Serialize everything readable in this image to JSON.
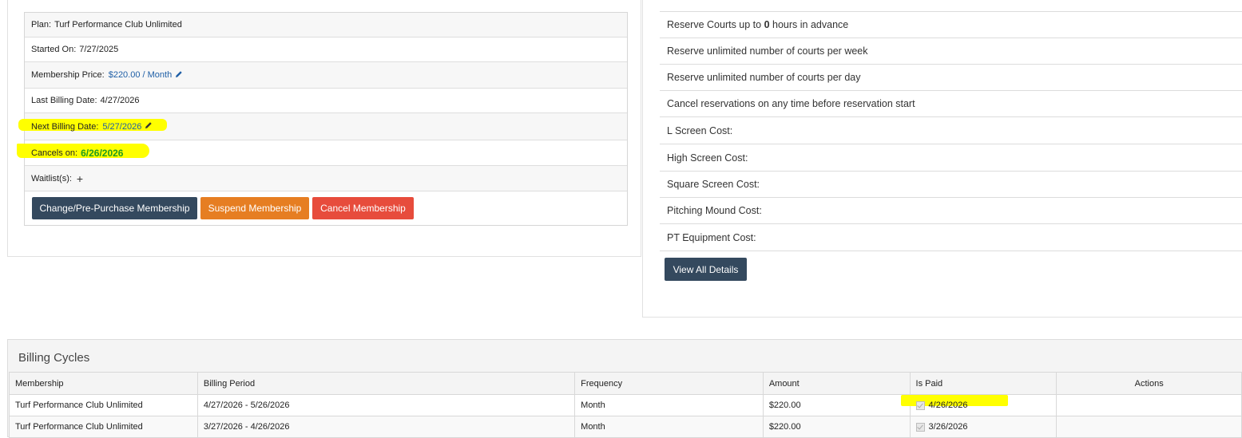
{
  "membership": {
    "plan_label": "Plan:",
    "plan_value": "Turf Performance Club Unlimited",
    "started_label": "Started On:",
    "started_value": "7/27/2025",
    "price_label": "Membership Price:",
    "price_value": "$220.00 / Month",
    "last_billing_label": "Last Billing Date:",
    "last_billing_value": "4/27/2026",
    "next_billing_label": "Next Billing Date:",
    "next_billing_value": "5/27/2026",
    "cancels_label": "Cancels on:",
    "cancels_value": "6/26/2026",
    "waitlist_label": "Waitlist(s):",
    "waitlist_add": "+",
    "buttons": {
      "change": "Change/Pre-Purchase Membership",
      "suspend": "Suspend Membership",
      "cancel": "Cancel Membership"
    }
  },
  "benefits": {
    "reserve_prefix": "Reserve Courts up to ",
    "reserve_hours": "0",
    "reserve_suffix": " hours in advance",
    "items": [
      "Reserve unlimited number of courts per week",
      "Reserve unlimited number of courts per day",
      "Cancel reservations on any time before reservation start",
      "L Screen Cost:",
      "High Screen Cost:",
      "Square Screen Cost:",
      "Pitching Mound Cost:",
      "PT Equipment Cost:"
    ],
    "view_all_label": "View All Details"
  },
  "billing": {
    "title": "Billing Cycles",
    "columns": [
      "Membership",
      "Billing Period",
      "Frequency",
      "Amount",
      "Is Paid",
      "Actions"
    ],
    "rows": [
      {
        "membership": "Turf Performance Club Unlimited",
        "period": "4/27/2026 - 5/26/2026",
        "frequency": "Month",
        "amount": "$220.00",
        "paid_date": "4/26/2026"
      },
      {
        "membership": "Turf Performance Club Unlimited",
        "period": "3/27/2026 - 4/26/2026",
        "frequency": "Month",
        "amount": "$220.00",
        "paid_date": "3/26/2026"
      }
    ]
  },
  "colors": {
    "dark_button": "#34495e",
    "orange_button": "#e67e22",
    "red_button": "#e74c3c",
    "link": "#1f5fa6",
    "cancel_date": "#1e9b1e",
    "highlight": "#ffff00"
  },
  "icons": {
    "edit": "pencil-icon",
    "add": "plus-icon",
    "paid": "checkbox-checked-icon"
  }
}
